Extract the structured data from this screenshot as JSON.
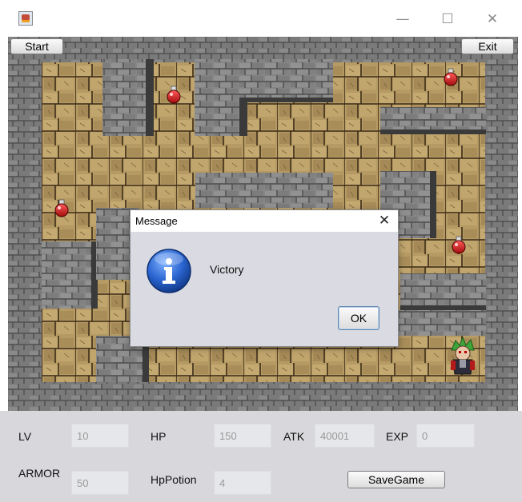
{
  "window": {
    "minimize_glyph": "—",
    "maximize_glyph": "☐",
    "close_glyph": "✕"
  },
  "toolbar": {
    "start_label": "Start",
    "exit_label": "Exit"
  },
  "board": {
    "theme": {
      "floor": "#b69a64",
      "floor_crack": "#3b2b17",
      "wall_face": "#848484",
      "wall_top": "#5f5f63",
      "wall_line": "#4a4a4a"
    },
    "potion_icon": "red-potion-icon",
    "hero_icon": "green-haired-hero-icon"
  },
  "stats": {
    "lv": {
      "label": "LV",
      "value": "10"
    },
    "hp": {
      "label": "HP",
      "value": "150"
    },
    "atk": {
      "label": "ATK",
      "value": "40001"
    },
    "exp": {
      "label": "EXP",
      "value": "0"
    },
    "armor": {
      "label": "ARMOR",
      "value": "50"
    },
    "hppotion": {
      "label": "HpPotion",
      "value": "4"
    },
    "save_label": "SaveGame"
  },
  "dialog": {
    "title": "Message",
    "close_glyph": "✕",
    "icon": "info-icon",
    "message": "Victory",
    "ok_label": "OK"
  }
}
